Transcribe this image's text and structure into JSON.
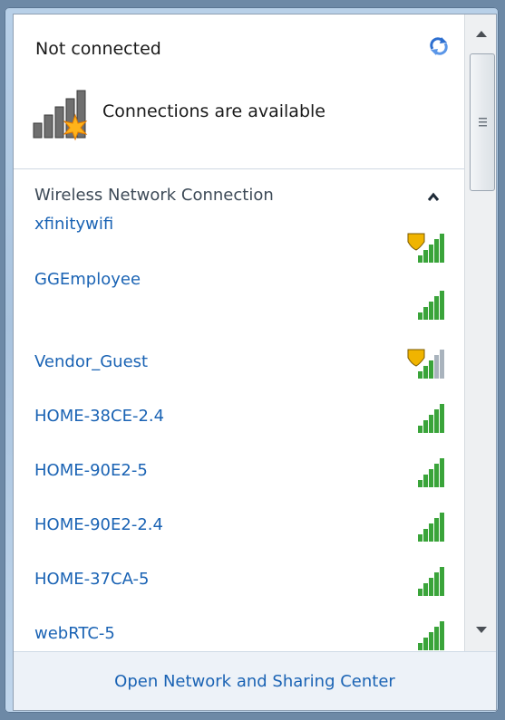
{
  "header": {
    "title": "Not connected",
    "status_text": "Connections are available",
    "refresh_icon": "refresh-icon",
    "status_icon": "signal-warning-icon"
  },
  "section": {
    "title": "Wireless Network Connection",
    "collapse_icon": "chevron-up-icon"
  },
  "networks": [
    {
      "name": "xfinitywifi",
      "secured": false,
      "shield": true,
      "strength": 5
    },
    {
      "name": "GGEmployee",
      "secured": false,
      "shield": false,
      "strength": 5
    },
    {
      "name": "Vendor_Guest",
      "secured": false,
      "shield": true,
      "strength": 3
    },
    {
      "name": "HOME-38CE-2.4",
      "secured": true,
      "shield": false,
      "strength": 5
    },
    {
      "name": "HOME-90E2-5",
      "secured": true,
      "shield": false,
      "strength": 5
    },
    {
      "name": "HOME-90E2-2.4",
      "secured": true,
      "shield": false,
      "strength": 5
    },
    {
      "name": "HOME-37CA-5",
      "secured": true,
      "shield": false,
      "strength": 5
    },
    {
      "name": "webRTC-5",
      "secured": true,
      "shield": false,
      "strength": 5
    }
  ],
  "footer": {
    "link": "Open Network and Sharing Center"
  },
  "colors": {
    "link": "#1a63b4",
    "signal": "#3aa43a",
    "signal_dim": "#a9b3bd"
  }
}
